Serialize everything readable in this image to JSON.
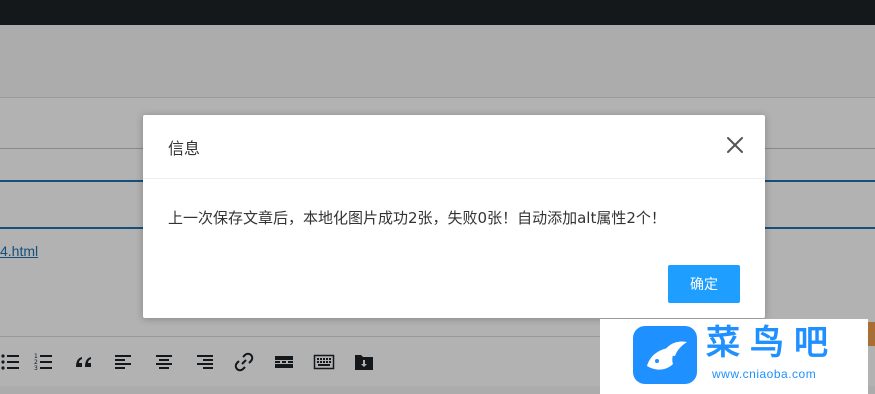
{
  "background": {
    "link_text": "4.html"
  },
  "toolbar": {
    "icons": [
      "bullet-list-icon",
      "numbered-list-icon",
      "blockquote-icon",
      "align-left-icon",
      "align-center-icon",
      "align-right-icon",
      "link-icon",
      "read-more-icon",
      "toolbar-toggle-icon",
      "download-folder-icon"
    ]
  },
  "dialog": {
    "title": "信息",
    "message": "上一次保存文章后，本地化图片成功2张，失败0张！自动添加alt属性2个！",
    "ok_label": "确定",
    "close_icon": "close-icon"
  },
  "watermark": {
    "brand": "菜鸟吧",
    "url": "www.cniaoba.com"
  },
  "colors": {
    "accent": "#1e9fff",
    "topbar": "#1d2327",
    "link": "#2271b1"
  }
}
